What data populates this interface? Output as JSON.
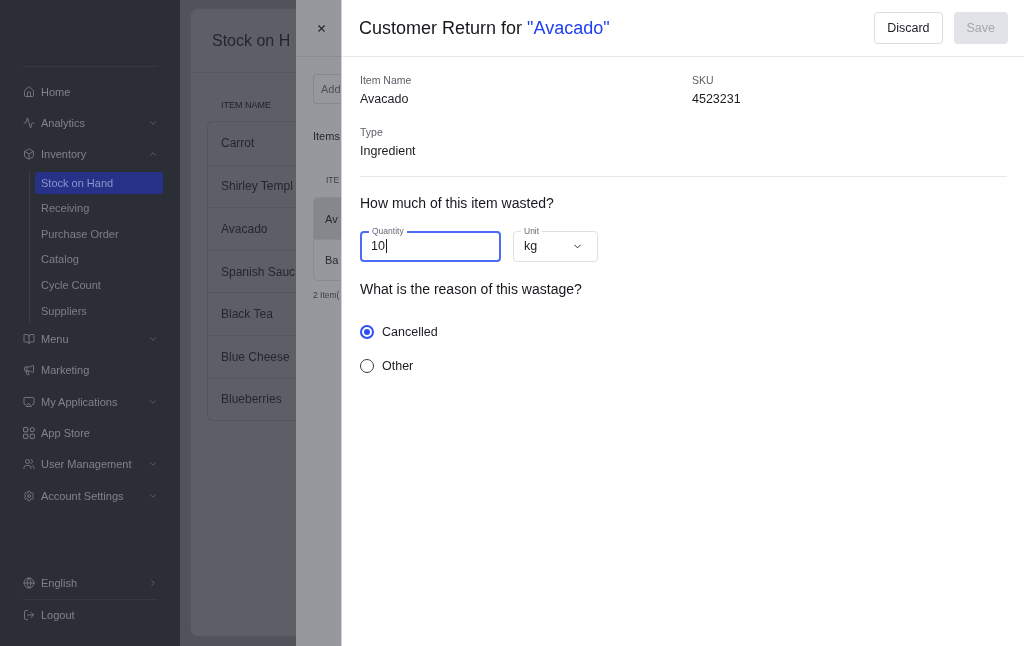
{
  "sidebar": {
    "items": [
      {
        "label": "Home",
        "kind": "link",
        "selected": false
      },
      {
        "label": "Analytics",
        "kind": "group",
        "selected": false,
        "expanded": false
      },
      {
        "label": "Inventory",
        "kind": "group",
        "selected": false,
        "expanded": true,
        "children": [
          {
            "label": "Stock on Hand",
            "selected": true
          },
          {
            "label": "Receiving",
            "selected": false
          },
          {
            "label": "Purchase Order",
            "selected": false
          },
          {
            "label": "Catalog",
            "selected": false
          },
          {
            "label": "Cycle Count",
            "selected": false
          },
          {
            "label": "Suppliers",
            "selected": false
          }
        ]
      },
      {
        "label": "Menu",
        "kind": "group",
        "selected": false,
        "expanded": false
      },
      {
        "label": "Marketing",
        "kind": "link",
        "selected": false
      },
      {
        "label": "My Applications",
        "kind": "group",
        "selected": false,
        "expanded": false
      },
      {
        "label": "App Store",
        "kind": "link",
        "selected": false
      },
      {
        "label": "User Management",
        "kind": "group",
        "selected": false,
        "expanded": false
      },
      {
        "label": "Account Settings",
        "kind": "group",
        "selected": false,
        "expanded": false
      }
    ],
    "footer_items": [
      {
        "label": "English",
        "kind": "submenu"
      },
      {
        "label": "Logout",
        "kind": "link"
      }
    ]
  },
  "stock_page": {
    "title": "Stock on H",
    "table": {
      "columns": [
        "ITEM NAME"
      ],
      "rows": [
        "Carrot",
        "Shirley Templ",
        "Avacado",
        "Spanish Sauc",
        "Black Tea",
        "Blue Cheese",
        "Blueberries"
      ]
    }
  },
  "items_drawer": {
    "add_field": {
      "placeholder": "Add"
    },
    "section_title": "Items",
    "table": {
      "columns": [
        "ITE"
      ],
      "rows": [
        {
          "name": "Av",
          "selected": true
        },
        {
          "name": "Ba",
          "selected": false
        }
      ]
    },
    "footer": "2 Item("
  },
  "return_drawer": {
    "title": "Customer Return for",
    "title_item": "\"Avacado\"",
    "buttons": [
      {
        "label": "Discard",
        "kind": "secondary",
        "disabled": false
      },
      {
        "label": "Save",
        "kind": "primary",
        "disabled": true
      }
    ],
    "details": [
      {
        "label": "Item Name",
        "value": "Avacado"
      },
      {
        "label": "SKU",
        "value": "4523231"
      },
      {
        "label": "Type",
        "value": "Ingredient"
      }
    ],
    "quantity_question": "How much of this item wasted?",
    "quantity": {
      "label": "Quantity",
      "value": "10",
      "focused": true
    },
    "unit": {
      "label": "Unit",
      "value": "kg"
    },
    "reason_question": "What is the reason of this wastage?",
    "reasons": [
      {
        "label": "Cancelled",
        "selected": true
      },
      {
        "label": "Other",
        "selected": false
      }
    ]
  }
}
